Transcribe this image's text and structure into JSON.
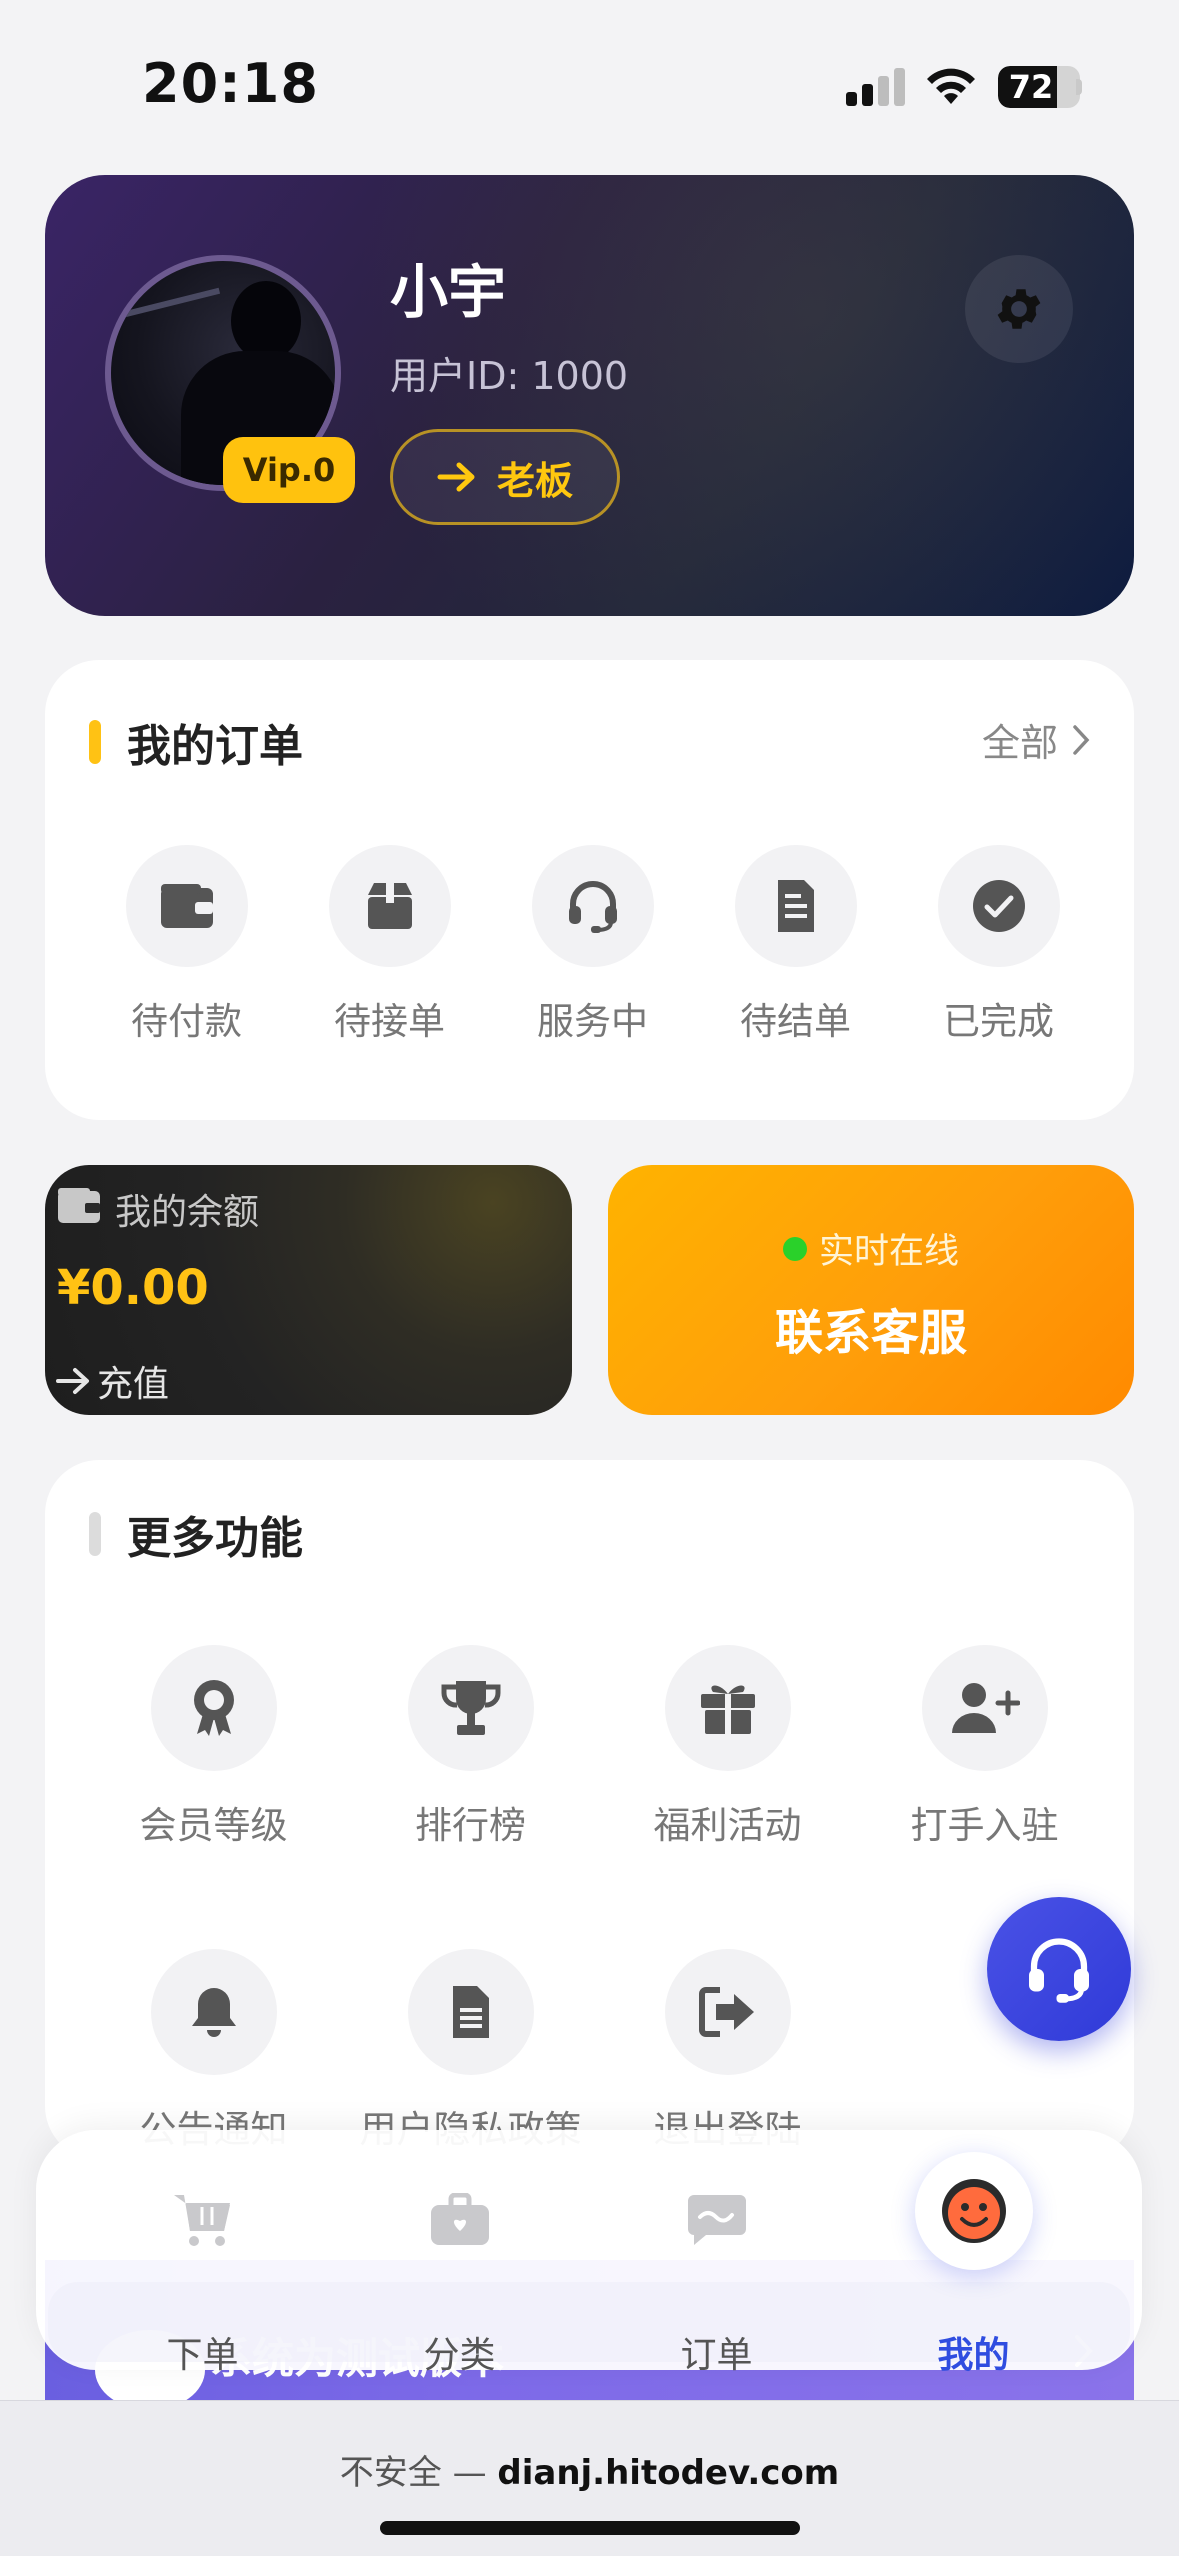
{
  "status_bar": {
    "time": "20:18",
    "battery_level": "72",
    "battery_fraction": 0.72
  },
  "profile": {
    "name": "小宇",
    "user_id": "用户ID: 1000",
    "vip": "Vip.0",
    "role_button": "老板"
  },
  "orders": {
    "title": "我的订单",
    "view_all": "全部",
    "items": [
      {
        "label": "待付款",
        "icon": "wallet-icon"
      },
      {
        "label": "待接单",
        "icon": "box-icon"
      },
      {
        "label": "服务中",
        "icon": "headset-icon"
      },
      {
        "label": "待结单",
        "icon": "receipt-icon"
      },
      {
        "label": "已完成",
        "icon": "check-circle-icon"
      }
    ]
  },
  "balance": {
    "title": "我的余额",
    "amount": "¥0.00",
    "recharge": "充值"
  },
  "service": {
    "status": "实时在线",
    "title": "联系客服"
  },
  "more": {
    "title": "更多功能",
    "items": [
      {
        "label": "会员等级",
        "icon": "award-icon"
      },
      {
        "label": "排行榜",
        "icon": "trophy-icon"
      },
      {
        "label": "福利活动",
        "icon": "gift-icon"
      },
      {
        "label": "打手入驻",
        "icon": "user-plus-icon"
      },
      {
        "label": "公告通知",
        "icon": "bell-icon"
      },
      {
        "label": "用户隐私政策",
        "icon": "document-icon"
      },
      {
        "label": "退出登陆",
        "icon": "logout-icon"
      }
    ]
  },
  "banner": {
    "text": "系统为测试版本"
  },
  "tabs": [
    {
      "label": "下单",
      "icon": "cart-icon"
    },
    {
      "label": "分类",
      "icon": "briefcase-icon"
    },
    {
      "label": "订单",
      "icon": "chat-icon"
    },
    {
      "label": "我的",
      "icon": "face-icon",
      "active": true
    }
  ],
  "browser": {
    "insecure": "不安全 —",
    "host": "dianj.hitodev.com"
  },
  "colors": {
    "accent": "#2f4de0",
    "gold": "#ffc214",
    "orange": "#ff9e0a",
    "online": "#2ad12a"
  }
}
